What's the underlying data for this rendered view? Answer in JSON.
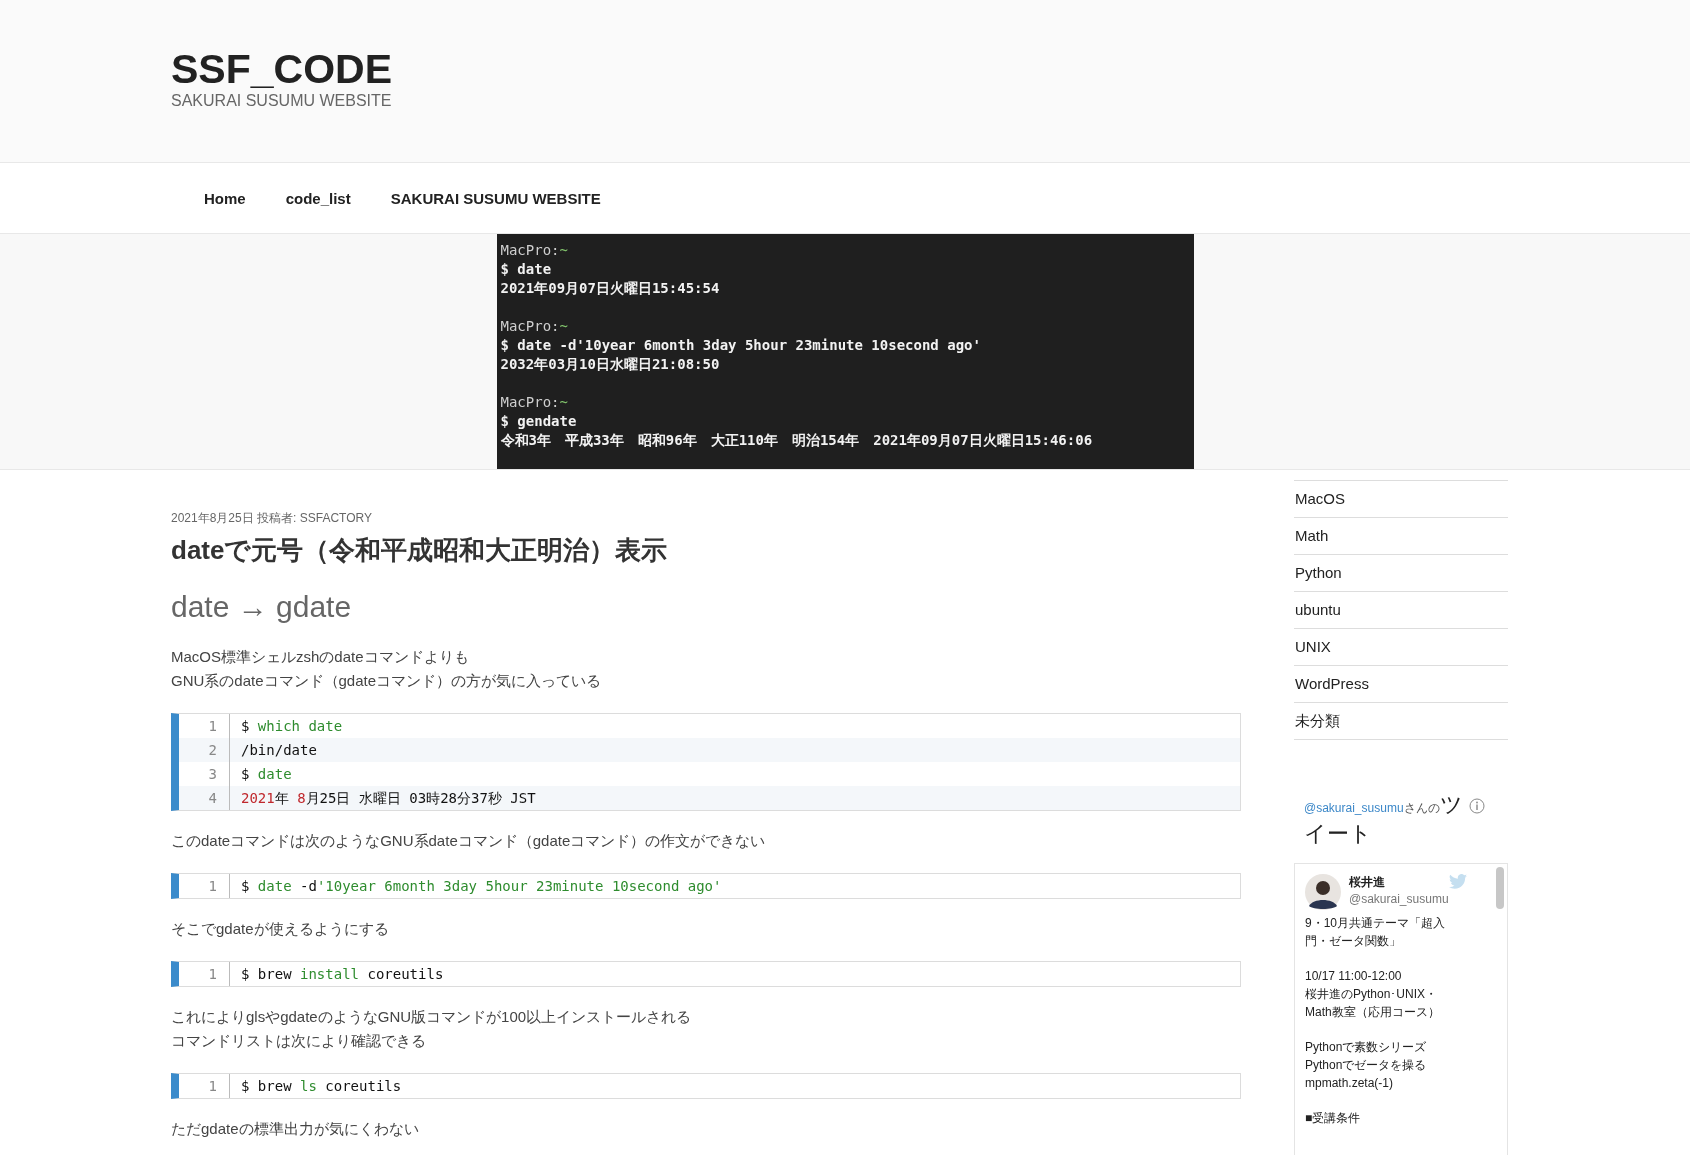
{
  "site": {
    "title": "SSF_CODE",
    "tagline": "SAKURAI SUSUMU WEBSITE"
  },
  "nav": [
    "Home",
    "code_list",
    "SAKURAI SUSUMU WEBSITE"
  ],
  "terminal": {
    "lines": [
      {
        "kind": "prompt",
        "host": "MacPro:",
        "dir": "~"
      },
      {
        "kind": "command",
        "text": "$ date"
      },
      {
        "kind": "output",
        "text": "2021年09月07日火曜日15:45:54"
      },
      {
        "kind": "blank"
      },
      {
        "kind": "prompt",
        "host": "MacPro:",
        "dir": "~"
      },
      {
        "kind": "command",
        "text": "$ date -d'10year 6month 3day 5hour 23minute 10second ago'"
      },
      {
        "kind": "output",
        "text": "2032年03月10日水曜日21:08:50"
      },
      {
        "kind": "blank"
      },
      {
        "kind": "prompt",
        "host": "MacPro:",
        "dir": "~"
      },
      {
        "kind": "command",
        "text": "$ gendate"
      },
      {
        "kind": "output",
        "text": "令和3年　平成33年　昭和96年　大正110年　明治154年　2021年09月07日火曜日15:46:06"
      }
    ]
  },
  "post": {
    "meta": "2021年8月25日 投稿者: SSFACTORY",
    "title": "dateで元号（令和平成昭和大正明治）表示",
    "heading": "date → gdate",
    "blocks": [
      {
        "kind": "text",
        "lines": [
          "MacOS標準シェルzshのdateコマンドよりも",
          "GNU系のdateコマンド（gdateコマンド）の方が気に入っている"
        ]
      },
      {
        "kind": "code",
        "lines": [
          {
            "number": "1",
            "segments": [
              {
                "text": "$ ",
                "kind": "plain"
              },
              {
                "text": "which date",
                "kind": "green"
              }
            ]
          },
          {
            "number": "2",
            "segments": [
              {
                "text": "/bin/date",
                "kind": "plain"
              }
            ]
          },
          {
            "number": "3",
            "segments": [
              {
                "text": "$ ",
                "kind": "plain"
              },
              {
                "text": "date",
                "kind": "green"
              }
            ]
          },
          {
            "number": "4",
            "segments": [
              {
                "text": "2021",
                "kind": "red"
              },
              {
                "text": "年 ",
                "kind": "plain"
              },
              {
                "text": "8",
                "kind": "red"
              },
              {
                "text": "月25日 水曜日 03時28分37秒 JST",
                "kind": "plain"
              }
            ]
          }
        ]
      },
      {
        "kind": "text",
        "lines": [
          "このdateコマンドは次のようなGNU系dateコマンド（gdateコマンド）の作文ができない"
        ]
      },
      {
        "kind": "code",
        "lines": [
          {
            "number": "1",
            "segments": [
              {
                "text": "$ ",
                "kind": "plain"
              },
              {
                "text": "date",
                "kind": "green"
              },
              {
                "text": " -d",
                "kind": "plain"
              },
              {
                "text": "'10year 6month 3day 5hour 23minute 10second ago'",
                "kind": "green"
              }
            ]
          }
        ]
      },
      {
        "kind": "text",
        "lines": [
          "そこでgdateが使えるようにする"
        ]
      },
      {
        "kind": "code",
        "lines": [
          {
            "number": "1",
            "segments": [
              {
                "text": "$ brew ",
                "kind": "plain"
              },
              {
                "text": "install",
                "kind": "green"
              },
              {
                "text": " coreutils",
                "kind": "plain"
              }
            ]
          }
        ]
      },
      {
        "kind": "text",
        "lines": [
          "これによりglsやgdateのようなGNU版コマンドが100以上インストールされる",
          "コマンドリストは次により確認できる"
        ]
      },
      {
        "kind": "code",
        "lines": [
          {
            "number": "1",
            "segments": [
              {
                "text": "$ brew ",
                "kind": "plain"
              },
              {
                "text": "ls",
                "kind": "green"
              },
              {
                "text": " coreutils",
                "kind": "plain"
              }
            ]
          }
        ]
      },
      {
        "kind": "text",
        "lines": [
          "ただgdateの標準出力が気にくわない"
        ]
      }
    ]
  },
  "sidebar": {
    "categories": [
      "MacOS",
      "Math",
      "Python",
      "ubuntu",
      "UNIX",
      "WordPress",
      "未分類"
    ],
    "tweets": {
      "handle_link": "@sakurai_susumu",
      "heading_suffix": "さんの",
      "heading_big": "ツイート",
      "author": "桜井進",
      "author_handle": "@sakurai_susumu",
      "paragraphs": [
        [
          "9・10月共通テーマ「超入門・ゼータ関数」"
        ],
        [
          "10/17 11:00-12:00",
          "桜井進のPython･UNIX・Math教室（応用コース）"
        ],
        [
          "Pythonで素数シリーズ",
          "Pythonでゼータを操る",
          "mpmath.zeta(-1)"
        ],
        [
          "■受講条件"
        ]
      ]
    }
  }
}
